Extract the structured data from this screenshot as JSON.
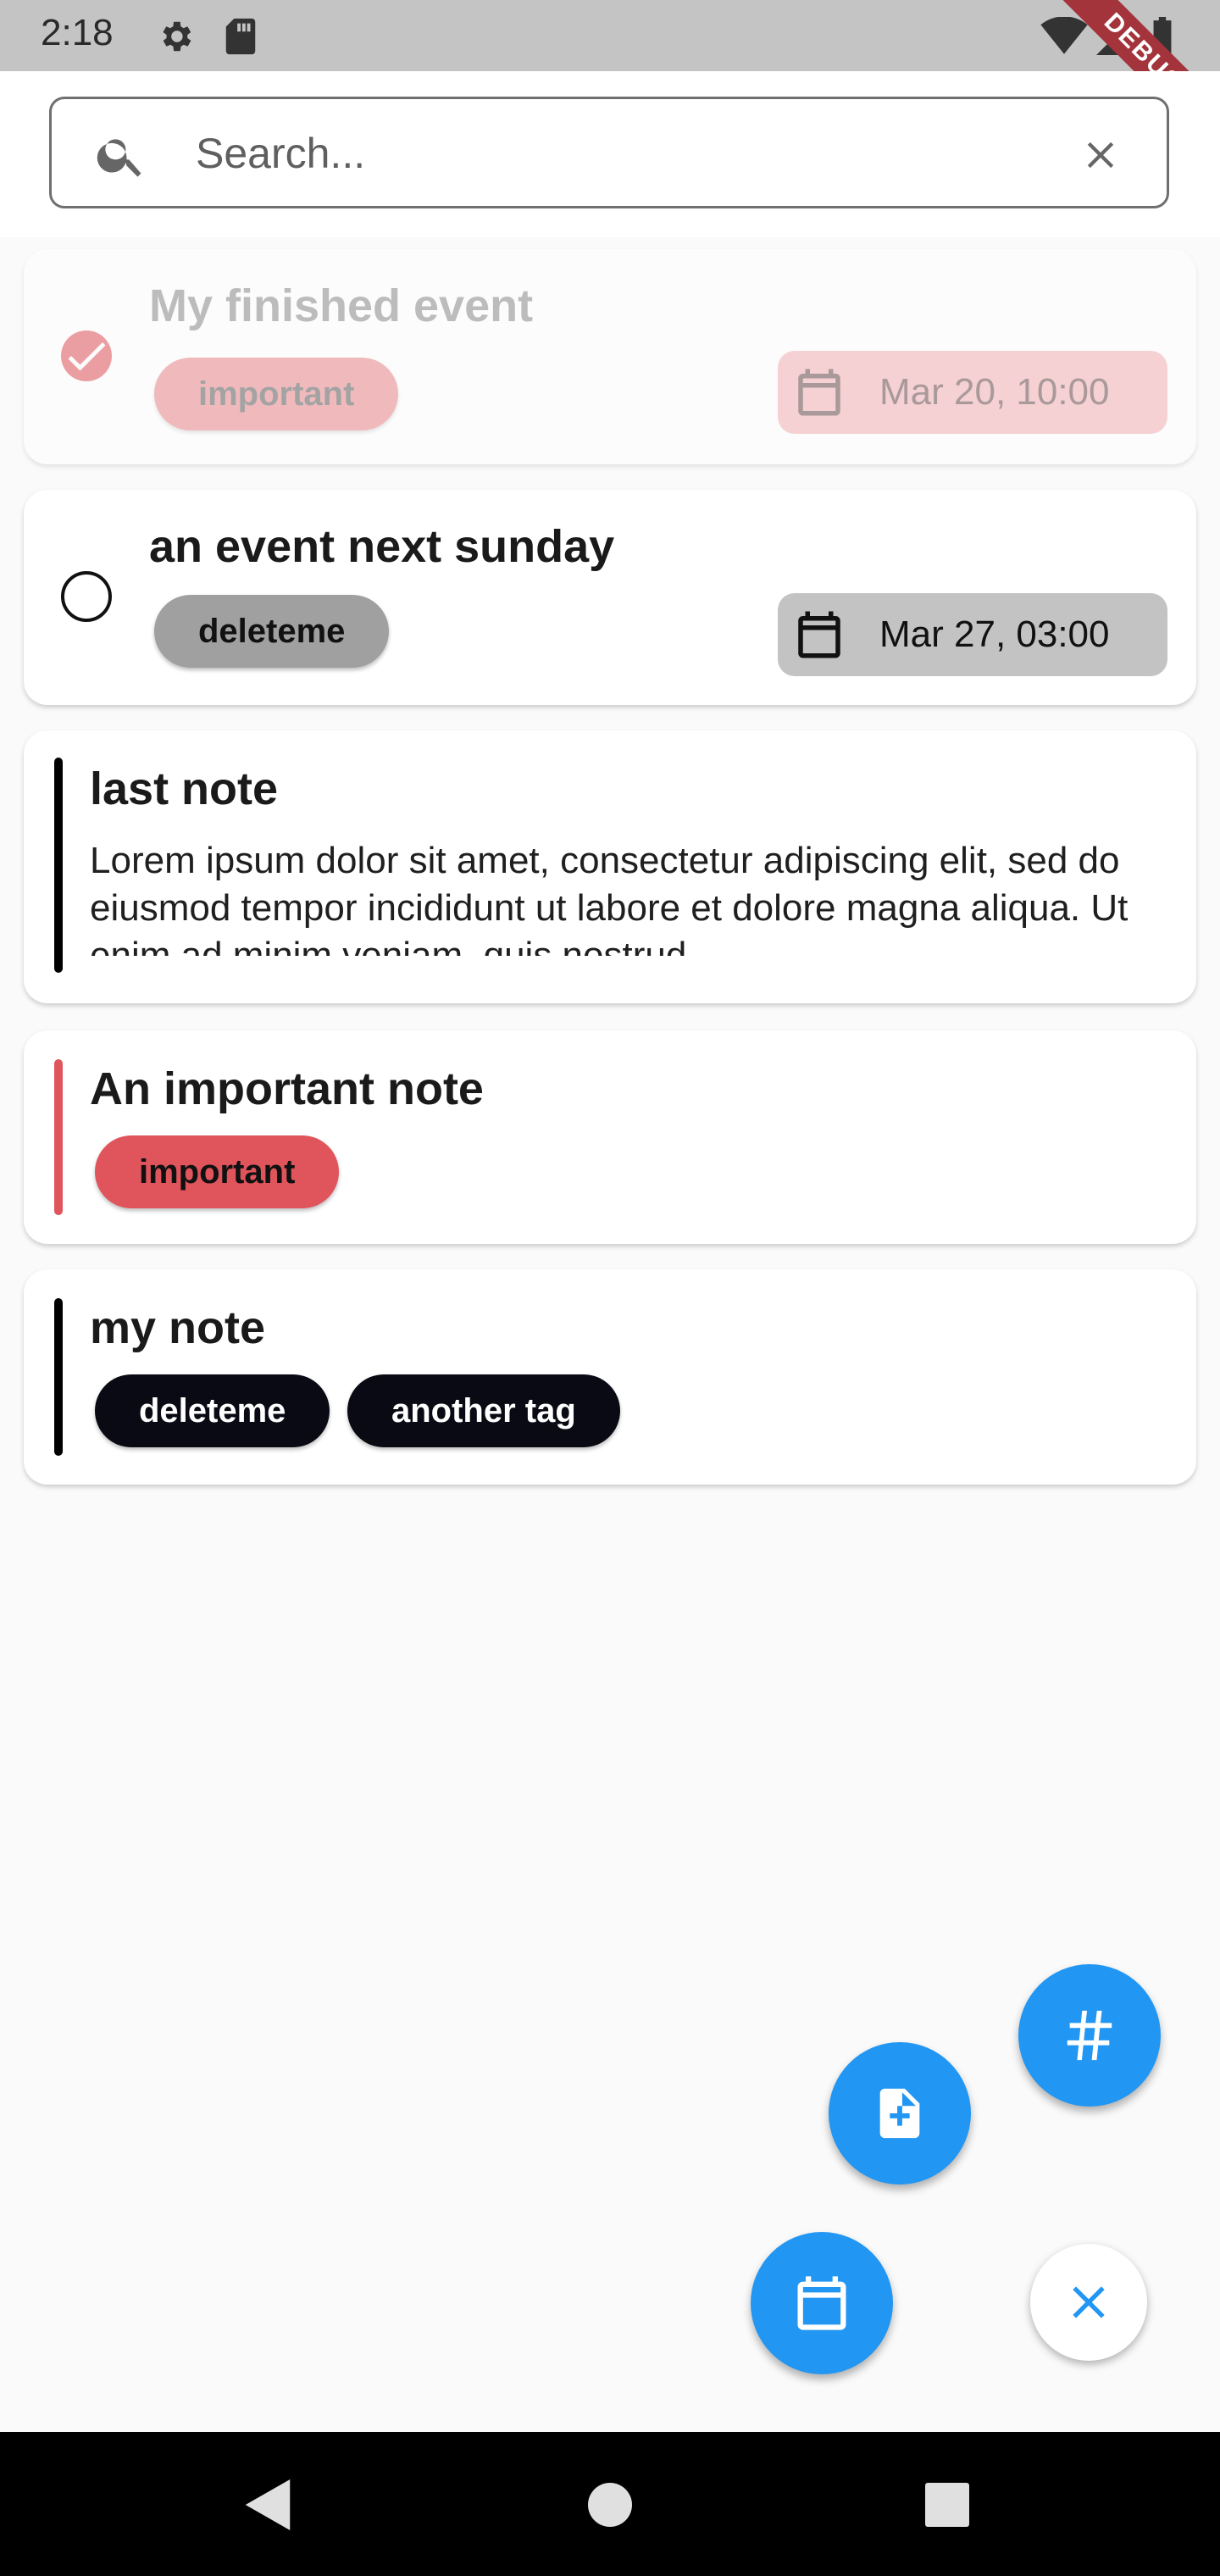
{
  "status_bar": {
    "time": "2:18",
    "icons": [
      "gear-icon",
      "sd-card-icon",
      "wifi-icon",
      "signal-icon",
      "battery-icon"
    ],
    "debug_banner": "DEBUG"
  },
  "search": {
    "placeholder": "Search...",
    "value": "",
    "icon": "search-icon",
    "clear_icon": "close-icon"
  },
  "items": [
    {
      "type": "event",
      "title": "My finished event",
      "finished": true,
      "tags": [
        "important"
      ],
      "date": "Mar 20, 10:00",
      "tag_color": "#e0545c",
      "date_bg": "#f2b0b4"
    },
    {
      "type": "event",
      "title": "an event next sunday",
      "finished": false,
      "tags": [
        "deleteme"
      ],
      "date": "Mar 27, 03:00",
      "tag_color": "#a0a0a0",
      "date_bg": "#c3c3c3"
    },
    {
      "type": "note",
      "title": "last note",
      "body": "Lorem ipsum dolor sit amet, consectetur adipiscing elit, sed do eiusmod tempor incididunt ut labore et dolore magna aliqua. Ut enim ad minim veniam, quis nostrud",
      "accent_color": "#000000"
    },
    {
      "type": "note",
      "title": "An important note",
      "tags": [
        "important"
      ],
      "accent_color": "#e0545c",
      "tag_color": "#e0545c"
    },
    {
      "type": "note",
      "title": "my note",
      "tags": [
        "deleteme",
        "another tag"
      ],
      "accent_color": "#000000",
      "tag_color": "#0a0a14"
    }
  ],
  "fabs": {
    "tag_icon": "hashtag-icon",
    "note_icon": "note-add-icon",
    "event_icon": "calendar-icon",
    "close_icon": "close-icon",
    "accent": "#2196f3"
  },
  "nav_bar": {
    "back_icon": "back-triangle-icon",
    "home_icon": "home-circle-icon",
    "recents_icon": "recents-square-icon"
  }
}
